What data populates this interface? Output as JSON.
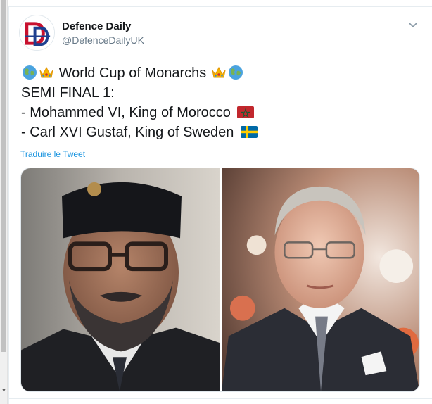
{
  "tweet": {
    "author_name": "Defence Daily",
    "author_handle": "@DefenceDailyUK",
    "avatar_letters": "DD",
    "lines": {
      "title": "World Cup of Monarchs",
      "semi_final": "SEMI FINAL 1:",
      "contender_1": "- Mohammed VI, King of Morocco",
      "contender_2": "- Carl XVI Gustaf, King of Sweden"
    },
    "icons": {
      "globe": "globe-icon",
      "crown": "crown-icon",
      "flag_morocco": "morocco-flag-icon",
      "flag_sweden": "sweden-flag-icon",
      "caret": "chevron-down-icon"
    },
    "translate_label": "Traduire le Tweet",
    "images": [
      {
        "name": "photo-mohammed-vi"
      },
      {
        "name": "photo-carl-xvi-gustaf"
      }
    ]
  },
  "colors": {
    "link": "#1b95e0",
    "handle": "#657786",
    "text": "#14171a",
    "avatar_red": "#c8102e",
    "avatar_blue": "#1d3f8f"
  }
}
